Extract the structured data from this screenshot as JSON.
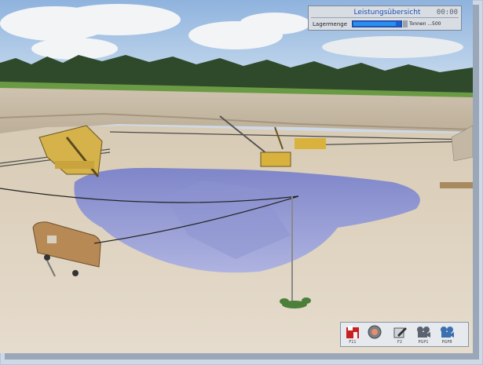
{
  "hud": {
    "title": "Leistungsübersicht",
    "clock": "00:00",
    "storage_label": "Lagermenge",
    "storage_fraction": 0.9,
    "storage_unit": "Tonnen ...500"
  },
  "toolbar": {
    "items": [
      {
        "icon": "building-icon",
        "key": "F11"
      },
      {
        "icon": "gear-head-icon",
        "key": ""
      },
      {
        "icon": "edit-icon",
        "key": "F2"
      },
      {
        "icon": "camera-icon",
        "key": "PGP1"
      },
      {
        "icon": "video-camera-icon",
        "key": "PGP8"
      }
    ]
  }
}
